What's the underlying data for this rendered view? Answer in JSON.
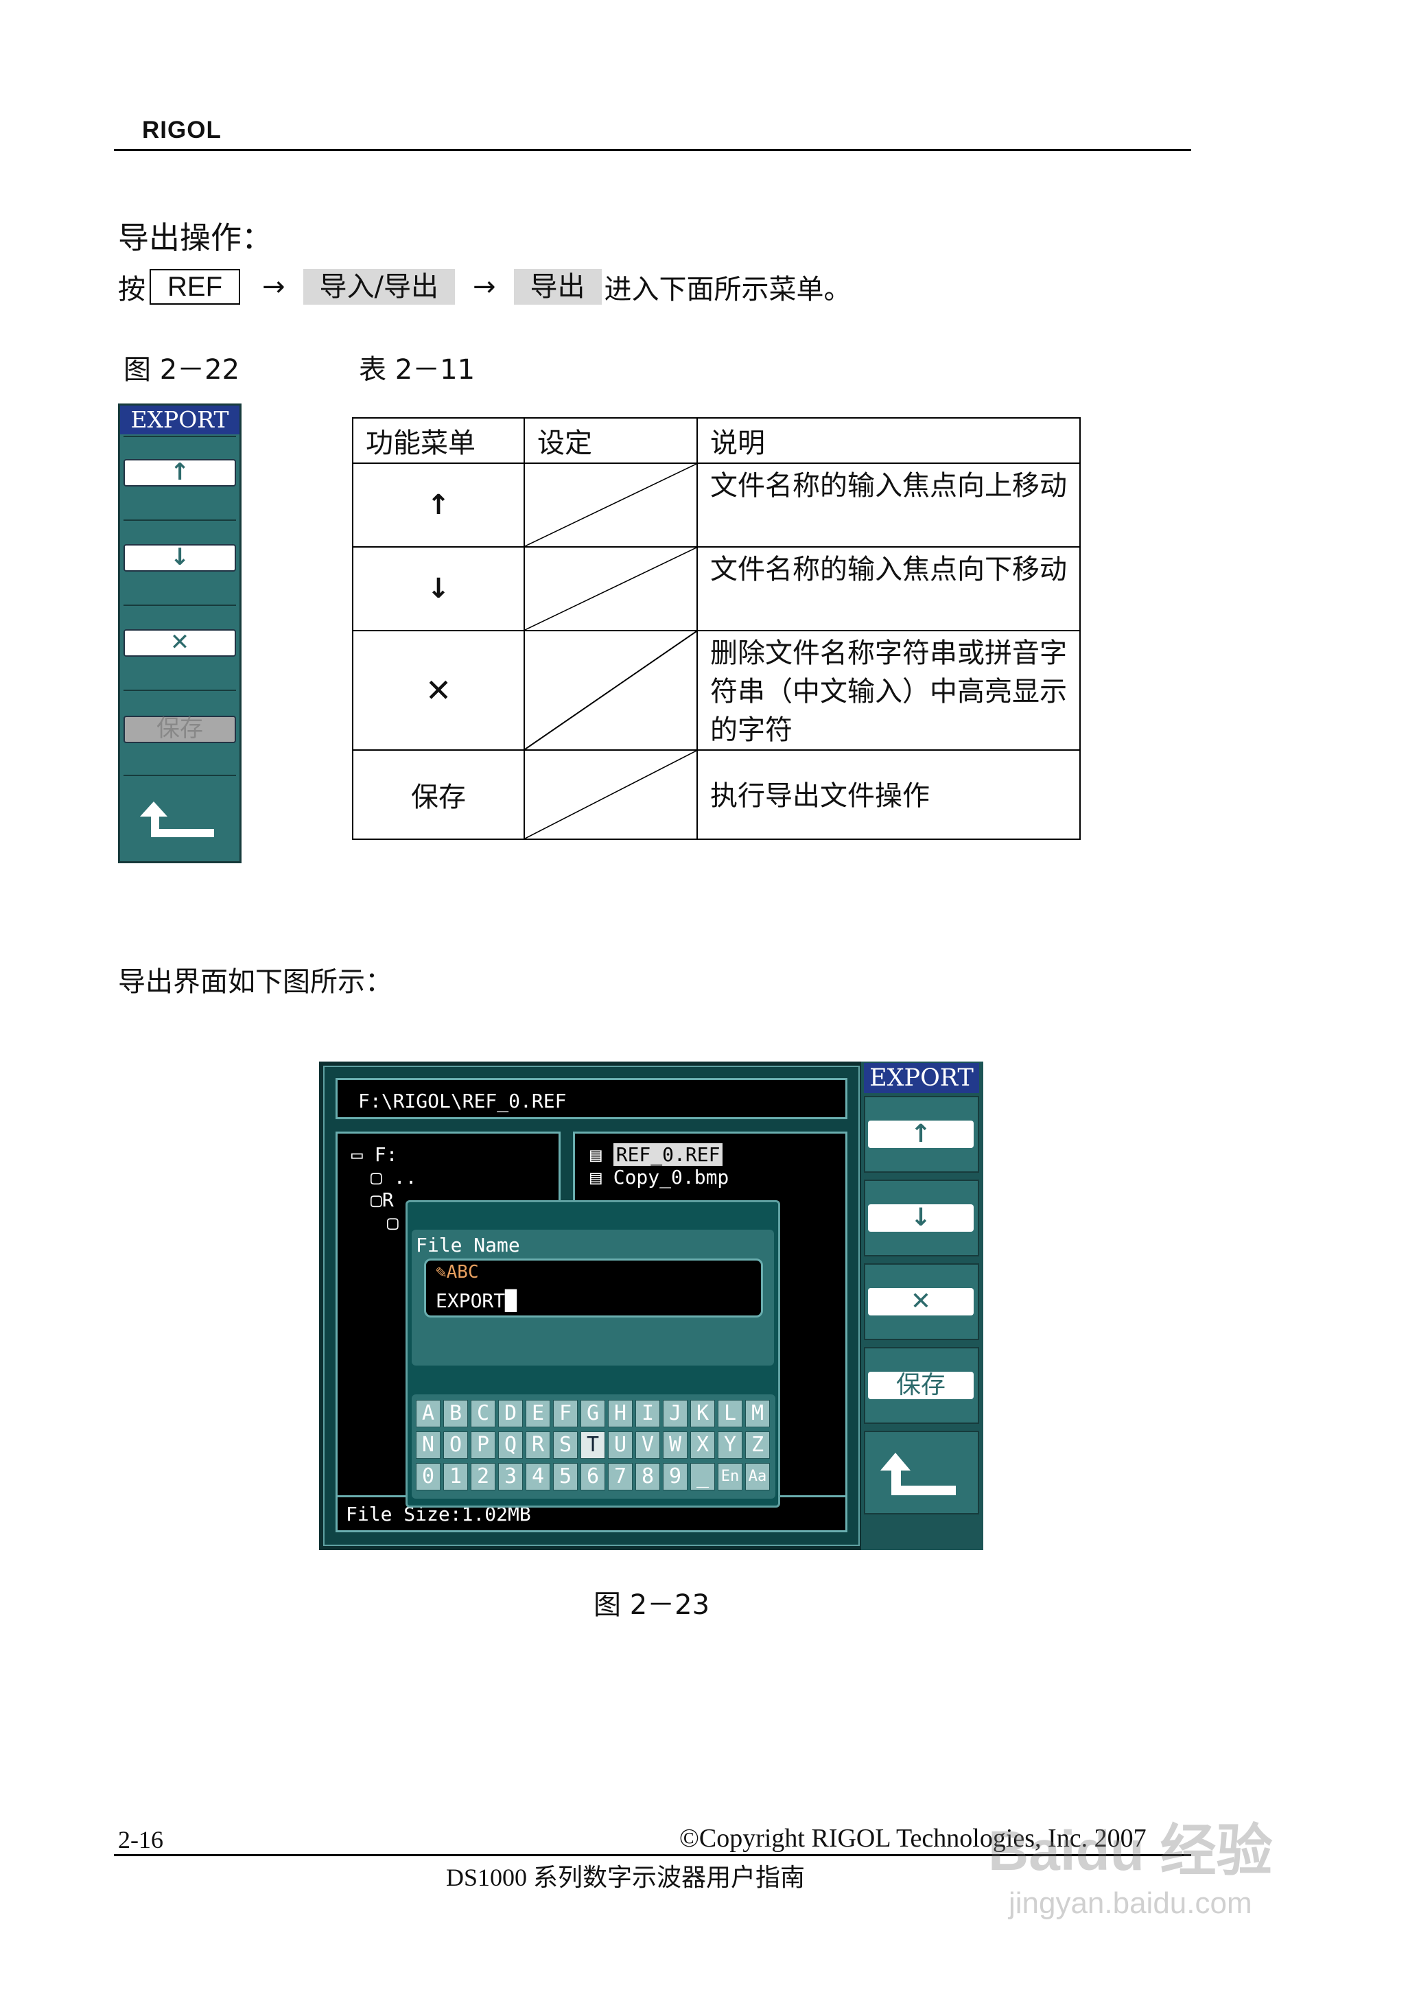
{
  "header": {
    "brand": "RIGOL"
  },
  "section": {
    "title": "导出操作：",
    "instr_prefix": "按",
    "key_ref": "REF",
    "arrow": "→",
    "softkey_1": "导入/导出",
    "softkey_2": "导出",
    "instr_suffix": "进入下面所示菜单。"
  },
  "figure_22": {
    "label": "图 2－22",
    "menu_title": "EXPORT",
    "items": [
      {
        "icon": "arrow-up-icon",
        "label": "↑"
      },
      {
        "icon": "arrow-down-icon",
        "label": "↓"
      },
      {
        "icon": "delete-icon",
        "label": "✕"
      },
      {
        "icon": "",
        "label": "保存"
      }
    ]
  },
  "table_11": {
    "label": "表 2－11",
    "headers": [
      "功能菜单",
      "设定",
      "说明"
    ],
    "rows": [
      {
        "menu": "↑",
        "setting": "",
        "desc": "文件名称的输入焦点向上移动"
      },
      {
        "menu": "↓",
        "setting": "",
        "desc": "文件名称的输入焦点向下移动"
      },
      {
        "menu": "✕",
        "setting": "",
        "desc": "删除文件名称字符串或拼音字符串（中文输入）中高亮显示的字符"
      },
      {
        "menu": "保存",
        "setting": "",
        "desc": "执行导出文件操作"
      }
    ]
  },
  "export_text": "导出界面如下图所示：",
  "screenshot": {
    "path": "F:\\RIGOL\\REF_0.REF",
    "tree": {
      "drive": "F:",
      "up": "..",
      "folder_partial": "R"
    },
    "files": [
      "REF_0.REF",
      "Copy_0.bmp"
    ],
    "dialog_title": "File Name",
    "input_mode": "ABC",
    "filename": "EXPORT",
    "keyboard_rows": [
      [
        "A",
        "B",
        "C",
        "D",
        "E",
        "F",
        "G",
        "H",
        "I",
        "J",
        "K",
        "L",
        "M"
      ],
      [
        "N",
        "O",
        "P",
        "Q",
        "R",
        "S",
        "T",
        "U",
        "V",
        "W",
        "X",
        "Y",
        "Z"
      ],
      [
        "0",
        "1",
        "2",
        "3",
        "4",
        "5",
        "6",
        "7",
        "8",
        "9",
        "_",
        "En",
        "Aa"
      ]
    ],
    "selected_key": "T",
    "file_size": "File Size:1.02MB",
    "menu_title": "EXPORT",
    "save_label": "保存"
  },
  "figure_23": {
    "label": "图 2－23"
  },
  "footer": {
    "page_num": "2-16",
    "copyright": "©Copyright RIGOL Technologies, Inc. 2007",
    "subtitle": "DS1000 系列数字示波器用户指南"
  },
  "watermark": {
    "text1": "Baidu 经验",
    "text2": "jingyan.baidu.com"
  }
}
